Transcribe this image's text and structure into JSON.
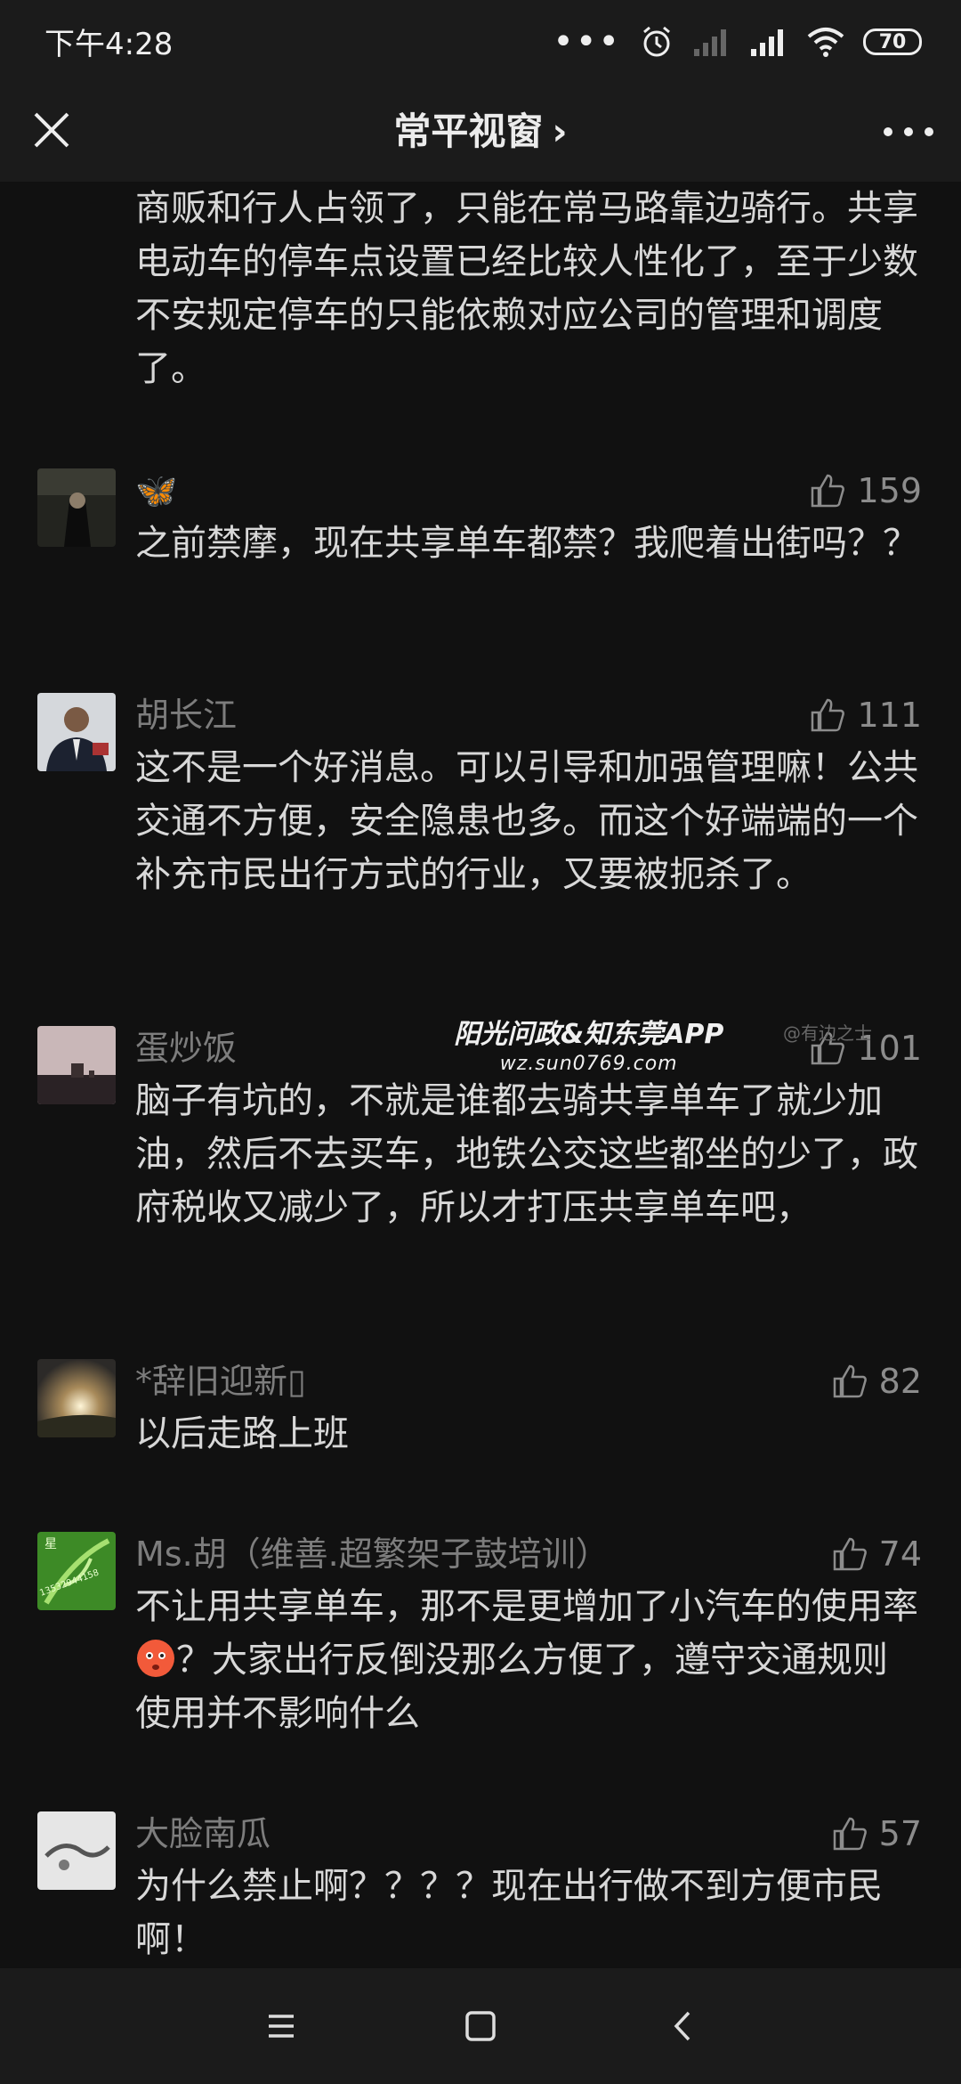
{
  "status": {
    "time": "下午4:28",
    "battery": "70"
  },
  "header": {
    "title": "常平视窗",
    "chevron": "›"
  },
  "top_text": "商贩和行人占领了，只能在常马路靠边骑行。共享电动车的停车点设置已经比较人性化了，至于少数不安规定停车的只能依赖对应公司的管理和调度了。",
  "comments": [
    {
      "author": "🦋",
      "likes": "159",
      "text": "之前禁摩，现在共享单车都禁？我爬着出街吗？？"
    },
    {
      "author": "胡长江",
      "likes": "111",
      "text": "这不是一个好消息。可以引导和加强管理嘛！公共交通不方便，安全隐患也多。而这个好端端的一个补充市民出行方式的行业，又要被扼杀了。"
    },
    {
      "author": "蛋炒饭",
      "likes": "101",
      "text": "脑子有坑的，不就是谁都去骑共享单车了就少加油，然后不去买车，地铁公交这些都坐的少了，政府税收又减少了，所以才打压共享单车吧，"
    },
    {
      "author": "*辞旧迎新▯",
      "likes": "82",
      "text": "以后走路上班"
    },
    {
      "author": "Ms.胡（维善.超繁架子鼓培训）",
      "likes": "74",
      "text_a": "不让用共享单车，那不是更增加了小汽车的使用率",
      "text_b": "？大家出行反倒没那么方便了，遵守交通规则使用并不影响什么"
    },
    {
      "author": "大脸南瓜",
      "likes": "57",
      "text": "为什么禁止啊？？？？现在出行做不到方便市民啊！"
    }
  ],
  "watermark": {
    "line1": "阳光问政&知东莞APP",
    "line2": "wz.sun0769.com",
    "line3": "@有边之士"
  },
  "avatar_texts": {
    "ms_hu_char": "星",
    "ms_hu_phone": "13532944158"
  },
  "colors": {
    "background": "#111111",
    "bar": "#1b1b1b",
    "author": "#7d7d7d",
    "text": "#d8d8d8"
  },
  "icons": [
    "close-icon",
    "more-icon",
    "like-icon",
    "menu-icon",
    "home-icon",
    "back-icon"
  ]
}
